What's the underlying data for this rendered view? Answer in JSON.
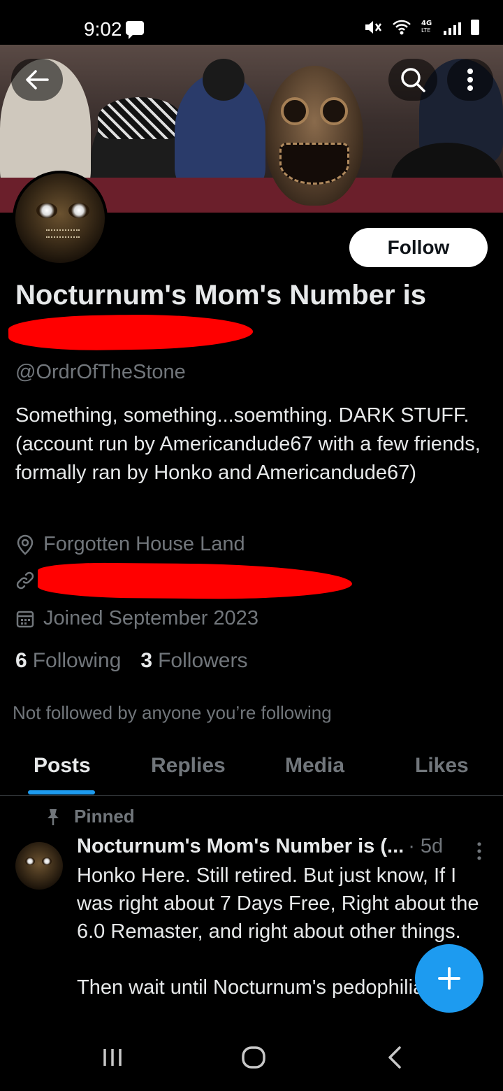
{
  "status_bar": {
    "time": "9:02",
    "icons": [
      "message-icon",
      "mute-icon",
      "wifi-icon",
      "4g-lte-icon",
      "signal-icon",
      "battery-icon"
    ],
    "network_label": "4G LTE"
  },
  "header": {
    "back_icon": "arrow-left-icon",
    "search_icon": "search-icon",
    "more_icon": "more-vertical-icon"
  },
  "profile": {
    "display_name": "Nocturnum's Mom's Number is",
    "handle": "@OrdrOfTheStone",
    "follow_label": "Follow",
    "bio": "Something, something...soemthing. DARK STUFF. (account run by Americandude67 with a few friends, formally ran by Honko and Americandude67)",
    "location": "Forgotten House Land",
    "joined": "Joined September 2023",
    "following_count": "6",
    "following_label": "Following",
    "followers_count": "3",
    "followers_label": "Followers",
    "not_followed_text": "Not followed by anyone you’re following"
  },
  "tabs": [
    {
      "label": "Posts",
      "active": true
    },
    {
      "label": "Replies",
      "active": false
    },
    {
      "label": "Media",
      "active": false
    },
    {
      "label": "Likes",
      "active": false
    }
  ],
  "pinned_post": {
    "pinned_label": "Pinned",
    "author": "Nocturnum's Mom's Number is (...",
    "time": "· 5d",
    "body": "Honko Here. Still retired. But just know, If I was right about 7 Days Free, Right about the 6.0 Remaster, and right about other things.\n\nThen wait until Nocturnum's pedophilia"
  },
  "colors": {
    "background": "#000000",
    "primary_text": "#e7e9ea",
    "secondary_text": "#71767b",
    "accent": "#1d9bf0",
    "redaction": "#ff0000"
  }
}
